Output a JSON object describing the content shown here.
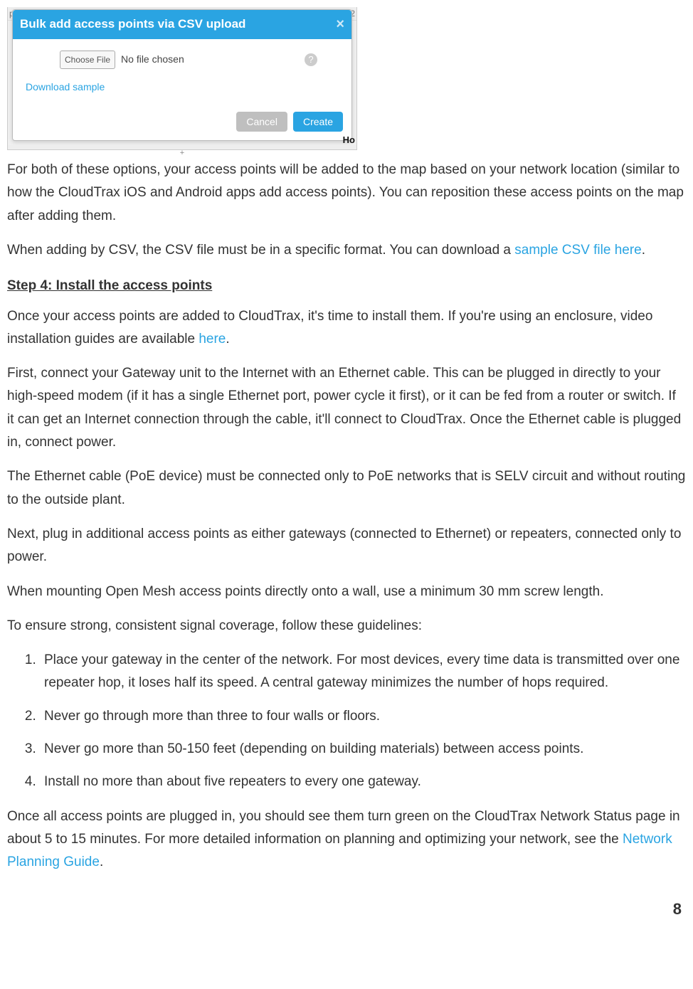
{
  "screenshot_bg": {
    "top_left": "p",
    "top_right": "2",
    "mid_marker": "+",
    "bottom_right": "Ho"
  },
  "dialog": {
    "title": "Bulk add access points via CSV upload",
    "close": "×",
    "choose_file": "Choose File",
    "no_file": "No file chosen",
    "help": "?",
    "download_sample": "Download sample",
    "cancel": "Cancel",
    "create": "Create"
  },
  "body": {
    "intro": "For both of these options, your access points will be added to the map based on your network location (similar to how the CloudTrax iOS and Android apps add access points). You can reposition these access points on the map after adding them.",
    "csv1": "When adding by CSV, the CSV file must be in a specific format. You can download a ",
    "csv_link": "sample CSV file here",
    "csv_post": ".",
    "step4_heading": "Step 4: Install the access points",
    "step4_p1_a": "Once your access points are added to CloudTrax, it's time to install them. If you're using an enclosure, video installation guides are available ",
    "step4_p1_link": "here",
    "step4_p1_b": ".",
    "p_gateway": "First, connect your Gateway unit to the Internet with an Ethernet cable. This can be plugged in directly to your high-speed modem (if it has a single Ethernet port, power cycle it first), or it can be fed from a router or switch. If it can get an Internet connection through the cable, it'll connect to CloudTrax. Once the Ethernet cable is plugged in, connect power.",
    "p_poe": "The Ethernet cable (PoE device) must be connected only to PoE networks that is SELV circuit and without routing to the outside plant.",
    "p_repeaters": "Next, plug in additional access points as either gateways (connected to Ethernet) or repeaters, connected only to power.",
    "p_mount": "When mounting Open Mesh access points directly onto a wall, use a minimum 30 mm screw length.",
    "p_guidelines_intro": "To ensure strong, consistent signal coverage, follow these guidelines:",
    "guidelines": [
      "Place your gateway in the center of the network. For most devices, every time data is transmitted over one repeater hop, it loses half its speed. A central gateway minimizes the number of hops required.",
      "Never go through more than three to four walls or floors.",
      "Never go more than 50-150 feet (depending on building materials) between access points.",
      "Install no more than about five repeaters to every one gateway."
    ],
    "p_final_a": "Once all access points are plugged in, you should see them turn green on the CloudTrax Network Status page in about 5 to 15 minutes. For more detailed information on planning and optimizing your network, see the ",
    "p_final_link": "Network Planning Guide",
    "p_final_b": "."
  },
  "page_number": "8"
}
